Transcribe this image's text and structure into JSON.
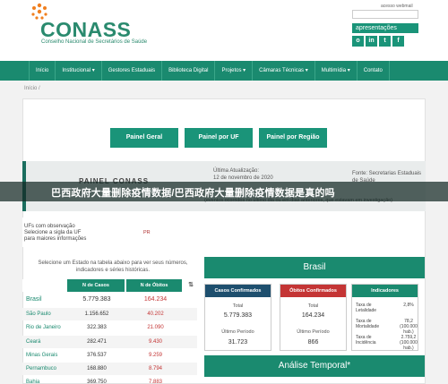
{
  "header": {
    "logo_text": "CONASS",
    "logo_subtitle": "Conselho Nacional de Secretários de Saúde",
    "webmail": "acesso webmail",
    "apresentacoes": "apresentações",
    "social": [
      "o",
      "in",
      "t",
      "f"
    ]
  },
  "nav": {
    "items": [
      "Início",
      "Institucional ▾",
      "Gestores Estaduais",
      "Biblioteca Digital",
      "Projetos ▾",
      "Câmaras Técnicas ▾",
      "Multimídia ▾",
      "Contato"
    ]
  },
  "breadcrumb": "Início /",
  "tabs": [
    "Painel Geral",
    "Painel por UF",
    "Painel por Região"
  ],
  "banner": {
    "title": "PAINEL CONASS",
    "update_label": "Última Atualização:",
    "update_value": "12 de novembro de 2020",
    "source": "Fonte: Secretarias Estaduais de Saúde",
    "note": "(eventos ocorridos no último dia ou em dias anteriores, que estavam em investigação)"
  },
  "overlay": "巴西政府大量删除疫情数据/巴西政府大量删除疫情数据是真的吗",
  "uf": {
    "text_line1": "UFs com observação",
    "text_line2": "Selecione a sigla da UF",
    "text_line3": "para maiores informações",
    "value": "PR"
  },
  "select_note": "Selecione um Estado na tabela abaixo para ver seus números, indicadores e séries históricas.",
  "table": {
    "col_cases": "N de Casos",
    "col_deaths": "N de Óbitos",
    "menu": "⇅",
    "rows": [
      {
        "state": "Brasil",
        "cases": "5.779.383",
        "deaths": "164.234"
      },
      {
        "state": "São Paulo",
        "cases": "1.156.652",
        "deaths": "40.202"
      },
      {
        "state": "Rio de Janeiro",
        "cases": "322.383",
        "deaths": "21.090"
      },
      {
        "state": "Ceará",
        "cases": "282.471",
        "deaths": "9.430"
      },
      {
        "state": "Minas Gerais",
        "cases": "376.537",
        "deaths": "9.259"
      },
      {
        "state": "Pernambuco",
        "cases": "168.880",
        "deaths": "8.794"
      },
      {
        "state": "Bahia",
        "cases": "369.750",
        "deaths": "7.883"
      }
    ]
  },
  "brasil": {
    "title": "Brasil",
    "cases_card": {
      "head": "Casos Confirmados",
      "total_label": "Total",
      "total": "5.779.383",
      "last_label": "Último Período",
      "last": "31.723"
    },
    "deaths_card": {
      "head": "Óbitos Confirmados",
      "total_label": "Total",
      "total": "164.234",
      "last_label": "Último Período",
      "last": "866"
    },
    "indicators": {
      "head": "Indicadores",
      "rows": [
        {
          "label": "Taxa de Letalidade",
          "value": "2,8%"
        },
        {
          "label": "Taxa de Mortalidade",
          "value": "78,2 (100.000 hab.)"
        },
        {
          "label": "Taxa de Incidência",
          "value": "2.759,2 (100.000 hab.)"
        }
      ]
    }
  },
  "analise": "Análise Temporal*",
  "colors": {
    "primary": "#1a8a6f",
    "cases_head": "#1e4f6e",
    "deaths_head": "#c43535",
    "deaths_text": "#c43535"
  }
}
